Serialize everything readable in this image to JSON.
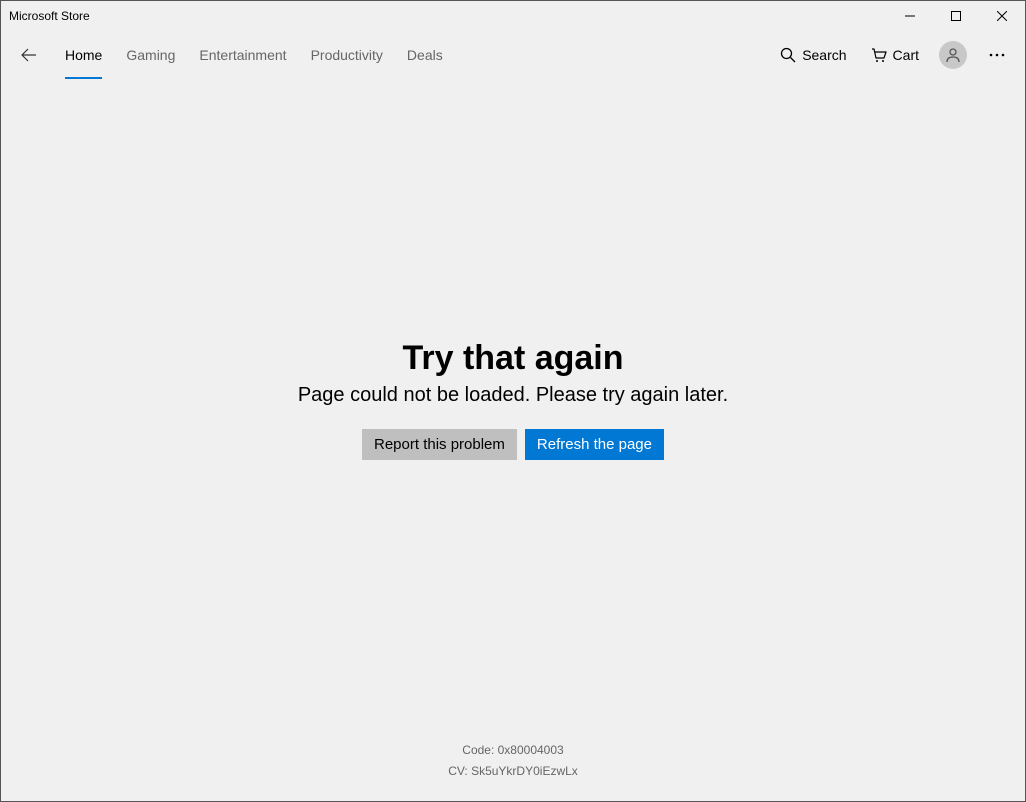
{
  "window": {
    "title": "Microsoft Store"
  },
  "nav": {
    "tabs": [
      {
        "label": "Home",
        "active": true
      },
      {
        "label": "Gaming",
        "active": false
      },
      {
        "label": "Entertainment",
        "active": false
      },
      {
        "label": "Productivity",
        "active": false
      },
      {
        "label": "Deals",
        "active": false
      }
    ],
    "search_label": "Search",
    "cart_label": "Cart"
  },
  "error": {
    "title": "Try that again",
    "message": "Page could not be loaded. Please try again later.",
    "report_label": "Report this problem",
    "refresh_label": "Refresh the page"
  },
  "footer": {
    "code": "Code: 0x80004003",
    "cv": "CV: Sk5uYkrDY0iEzwLx"
  }
}
